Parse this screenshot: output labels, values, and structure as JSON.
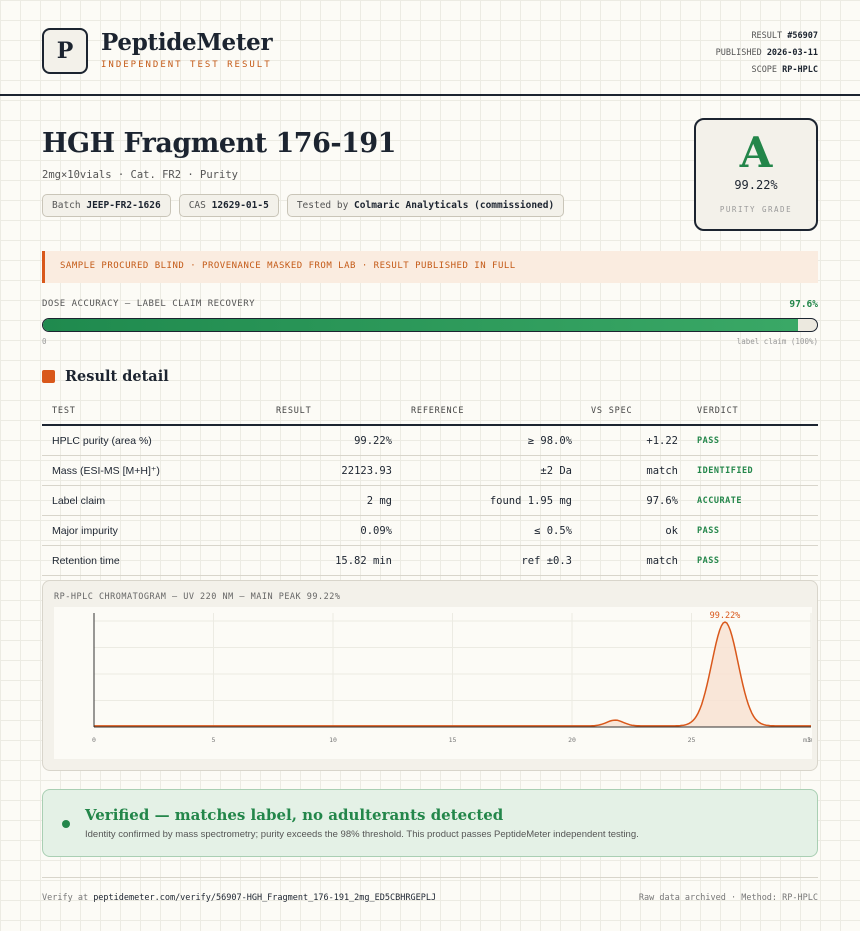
{
  "header": {
    "logo_letter": "P",
    "brand": "PeptideMeter",
    "tagline": "INDEPENDENT TEST RESULT",
    "meta": [
      {
        "label": "RESULT",
        "value": "#56907"
      },
      {
        "label": "PUBLISHED",
        "value": "2026-03-11"
      },
      {
        "label": "SCOPE",
        "value": "RP-HPLC"
      }
    ]
  },
  "product": {
    "title": "HGH Fragment 176-191",
    "subtitle": "2mg×10vials · Cat. FR2 · Purity",
    "chips": [
      {
        "label": "Batch",
        "value": "JEEP-FR2-1626"
      },
      {
        "label": "CAS",
        "value": "12629-01-5"
      },
      {
        "label": "Tested by",
        "value": "Colmaric Analyticals (commissioned)"
      }
    ]
  },
  "grade": {
    "letter": "A",
    "value": "99.22%",
    "label": "PURITY GRADE",
    "color": "#23864a"
  },
  "notice": {
    "text": "SAMPLE PROCURED BLIND · PROVENANCE MASKED FROM LAB · RESULT PUBLISHED IN FULL"
  },
  "dose": {
    "label": "DOSE ACCURACY — LABEL CLAIM RECOVERY",
    "value_text": "97.6%",
    "percent": 97.6,
    "min_label": "0",
    "max_label": "label claim (100%)"
  },
  "section": {
    "title": "Result detail"
  },
  "table": {
    "headers": [
      "TEST",
      "RESULT",
      "REFERENCE",
      "VS SPEC",
      "VERDICT"
    ],
    "rows": [
      {
        "test": "HPLC purity (area %)",
        "result": "99.22%",
        "reference": "≥ 98.0%",
        "vs": "+1.22",
        "verdict": "PASS"
      },
      {
        "test": "Mass (ESI-MS [M+H]⁺)",
        "result": "22123.93",
        "reference": "±2 Da",
        "vs": "match",
        "verdict": "IDENTIFIED"
      },
      {
        "test": "Label claim",
        "result": "2 mg",
        "reference": "found 1.95 mg",
        "vs": "97.6%",
        "verdict": "ACCURATE"
      },
      {
        "test": "Major impurity",
        "result": "0.09%",
        "reference": "≤ 0.5%",
        "vs": "ok",
        "verdict": "PASS"
      },
      {
        "test": "Retention time",
        "result": "15.82 min",
        "reference": "ref ±0.3",
        "vs": "match",
        "verdict": "PASS"
      }
    ]
  },
  "chromatogram": {
    "title": "RP-HPLC CHROMATOGRAM — UV 220 NM — MAIN PEAK 99.22%"
  },
  "chart_data": {
    "type": "line",
    "x_ticks": [
      "0",
      "5",
      "10",
      "15",
      "20",
      "25",
      "30"
    ],
    "x_unit": "min",
    "xlim": [
      0,
      30
    ],
    "ylim": [
      0,
      1
    ],
    "peaks": [
      {
        "center": 21.8,
        "height": 0.055,
        "width": 0.35
      },
      {
        "center": 26.4,
        "height": 0.98,
        "width": 0.55
      }
    ],
    "baseline": 0.01,
    "peak_label": "99.22%",
    "line_color": "#d9581b",
    "fill_color": "#f8e2d2"
  },
  "verified": {
    "title": "Verified — matches label, no adulterants detected",
    "description": "Identity confirmed by mass spectrometry; purity exceeds the 98% threshold. This product passes PeptideMeter independent testing."
  },
  "footer": {
    "verify_prefix": "Verify at",
    "verify_url": "peptidemeter.com/verify/56907-HGH_Fragment_176-191_2mg_ED5CBHRGEPLJ",
    "right": "Raw data archived · Method: RP-HPLC"
  }
}
